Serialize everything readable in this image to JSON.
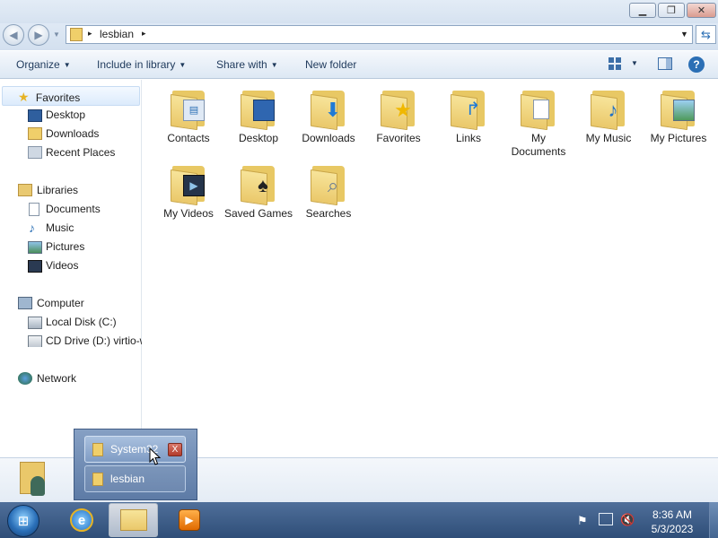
{
  "window": {
    "minimize_icon": "minimize-icon",
    "maximize_icon": "restore-icon",
    "close_icon": "close-icon"
  },
  "address": {
    "crumbs": [
      "lesbian"
    ],
    "separator": "▸"
  },
  "toolbar": {
    "organize": "Organize",
    "include_in_library": "Include in library",
    "share_with": "Share with",
    "new_folder": "New folder"
  },
  "nav": {
    "favorites": {
      "label": "Favorites",
      "items": [
        "Desktop",
        "Downloads",
        "Recent Places"
      ]
    },
    "libraries": {
      "label": "Libraries",
      "items": [
        "Documents",
        "Music",
        "Pictures",
        "Videos"
      ]
    },
    "computer": {
      "label": "Computer",
      "items": [
        "Local Disk (C:)",
        "CD Drive (D:) virtio-w"
      ]
    },
    "network": {
      "label": "Network"
    }
  },
  "content": {
    "items": [
      {
        "label": "Contacts",
        "icon": "contacts-icon"
      },
      {
        "label": "Desktop",
        "icon": "desktop-icon"
      },
      {
        "label": "Downloads",
        "icon": "downloads-icon"
      },
      {
        "label": "Favorites",
        "icon": "favorites-icon"
      },
      {
        "label": "Links",
        "icon": "links-icon"
      },
      {
        "label": "My Documents",
        "icon": "documents-icon"
      },
      {
        "label": "My Music",
        "icon": "music-icon"
      },
      {
        "label": "My Pictures",
        "icon": "pictures-icon"
      },
      {
        "label": "My Videos",
        "icon": "videos-icon"
      },
      {
        "label": "Saved Games",
        "icon": "saved-games-icon"
      },
      {
        "label": "Searches",
        "icon": "searches-icon"
      }
    ]
  },
  "popup": {
    "items": [
      "System32",
      "lesbian"
    ],
    "close_label": "X"
  },
  "taskbar": {
    "time": "8:36 AM",
    "date": "5/3/2023"
  },
  "colors": {
    "accent": "#2b6fb5",
    "taskbar": "#3a5c89",
    "folder": "#eac86a"
  }
}
